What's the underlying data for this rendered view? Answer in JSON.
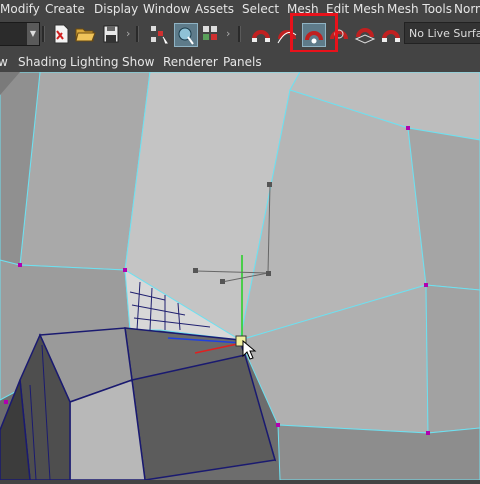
{
  "menu": {
    "items": [
      "Modify",
      "Create",
      "Display",
      "Window",
      "Assets",
      "Select",
      "Mesh",
      "Edit Mesh",
      "Mesh Tools",
      "Norm"
    ]
  },
  "toolbar": {
    "icons": [
      "new-scene-icon",
      "open-scene-icon",
      "save-scene-icon",
      "select-by-hierarchy-icon",
      "select-by-object-icon",
      "select-by-component-icon",
      "snap-to-grid-icon",
      "snap-to-curve-icon",
      "snap-to-point-icon",
      "snap-to-view-plane-icon",
      "snap-to-live-surface-icon",
      "make-live-icon"
    ],
    "live_surface": "No Live Surface",
    "highlighted": "snap-to-point-icon"
  },
  "panel_menu": {
    "items": [
      "w",
      "Shading",
      "Lighting",
      "Show",
      "Renderer",
      "Panels"
    ]
  },
  "colors": {
    "ui_bg": "#444444",
    "viewport_bg": "#6e6e6e",
    "mesh_edge": "#6ee0f0",
    "vertex": "#b000b0",
    "highlight": "#e8121b"
  }
}
